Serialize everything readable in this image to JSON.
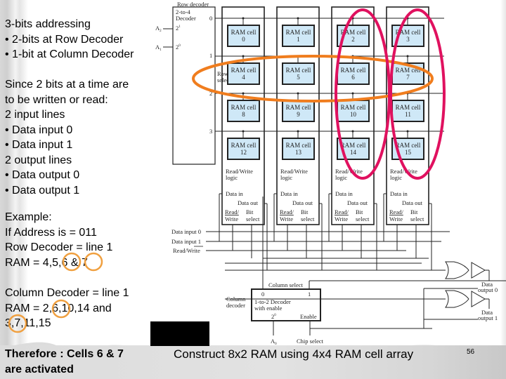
{
  "slide": {
    "intro": {
      "title": "3-bits addressing",
      "bullets": [
        "• 2-bits at Row Decoder",
        "• 1-bit at Column Decoder"
      ]
    },
    "lines": {
      "heading1": "Since 2 bits at a time are",
      "heading2": "to be written or read:",
      "input_heading": "2 input lines",
      "inputs": [
        "• Data input 0",
        "• Data input 1"
      ],
      "output_heading": "2 output lines",
      "outputs": [
        "• Data output 0",
        "• Data output 1"
      ]
    },
    "example": {
      "title": "Example:",
      "address": "If Address is = 011",
      "row_decoder": "Row Decoder = line 1",
      "row_ram": "RAM = 4,5,6 & 7",
      "column_decoder": "Column Decoder = line 1",
      "column_ram_1": "RAM = 2,6,10,14 and",
      "column_ram_2": "3,7,11,15"
    },
    "conclusion": {
      "line1": "Therefore : Cells 6 & 7",
      "line2": "are activated"
    },
    "caption": "Construct 8x2 RAM using 4x4 RAM cell array",
    "slide_number": "56"
  },
  "diagram": {
    "row_decoder": {
      "title": "Row decoder",
      "type_line1": "2-to-4",
      "type_line2": "Decoder",
      "input_a2": "A",
      "input_a2_sub": "2",
      "input_a1": "A",
      "input_a1_sub": "1",
      "weight_high": "2",
      "weight_high_sup": "1",
      "weight_low": "2",
      "weight_low_sup": "0",
      "outputs": [
        "0",
        "1",
        "2",
        "3"
      ],
      "row_select_1": "Row",
      "row_select_2": "select"
    },
    "cell_label": "RAM cell",
    "cells": [
      "0",
      "1",
      "2",
      "3",
      "4",
      "5",
      "6",
      "7",
      "8",
      "9",
      "10",
      "11",
      "12",
      "13",
      "14",
      "15"
    ],
    "column_block": {
      "rw_logic_1": "Read/Write",
      "rw_logic_2": "logic",
      "data_in": "Data in",
      "data_out": "Data out",
      "read": "Read/",
      "write": "Write",
      "bit": "Bit",
      "select": "select"
    },
    "bus_labels": {
      "data_input_0": "Data input 0",
      "data_input_1": "Data input 1",
      "read_write": "Read/Write"
    },
    "column_decoder": {
      "label_1": "Column",
      "label_2": "decoder",
      "column_select": "Column select",
      "out0": "0",
      "out1": "1",
      "type_line1": "1-to-2 Decoder",
      "type_line2": "with enable",
      "input_weight": "2",
      "input_weight_sup": "0",
      "enable": "Enable",
      "address_input": "A",
      "address_input_sub": "0",
      "chip_select": "Chip select"
    },
    "outputs": {
      "data_output_0_1": "Data",
      "data_output_0_2": "output 0",
      "data_output_1_1": "Data",
      "data_output_1_2": "output 1"
    },
    "highlight_colors": {
      "row_highlight": "#f07d1e",
      "column_highlight": "#e0115f",
      "cell_fill": "#cfe8f7",
      "example_circle": "#f0a040"
    }
  }
}
